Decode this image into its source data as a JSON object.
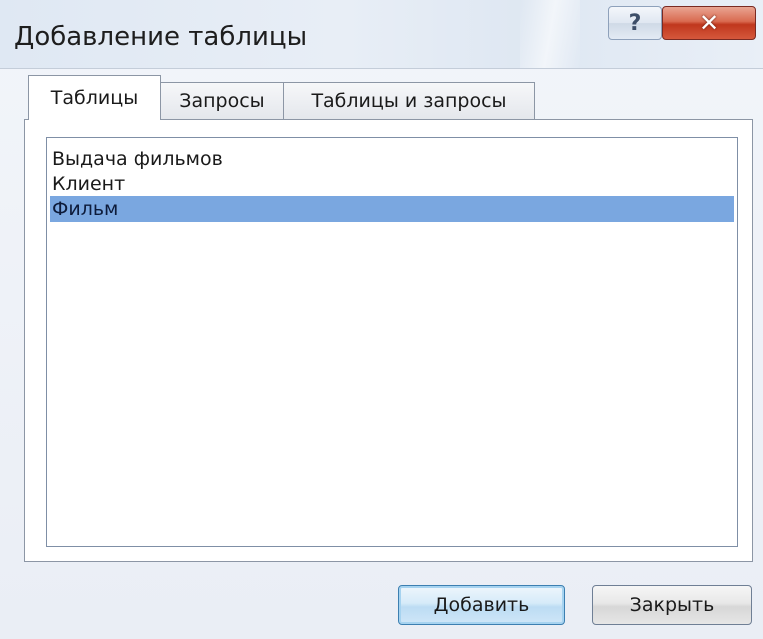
{
  "window": {
    "title": "Добавление таблицы",
    "help_glyph": "?",
    "close_glyph": "✕"
  },
  "tabs": [
    {
      "label": "Таблицы",
      "active": true
    },
    {
      "label": "Запросы",
      "active": false
    },
    {
      "label": "Таблицы и запросы",
      "active": false
    }
  ],
  "list": {
    "items": [
      {
        "label": "Выдача фильмов",
        "selected": false
      },
      {
        "label": "Клиент",
        "selected": false
      },
      {
        "label": "Фильм",
        "selected": true
      }
    ],
    "selection_color": "#7aa7e0"
  },
  "buttons": {
    "add_label": "Добавить",
    "close_label": "Закрыть"
  },
  "icons": {
    "help": "help-icon",
    "close": "close-icon"
  }
}
